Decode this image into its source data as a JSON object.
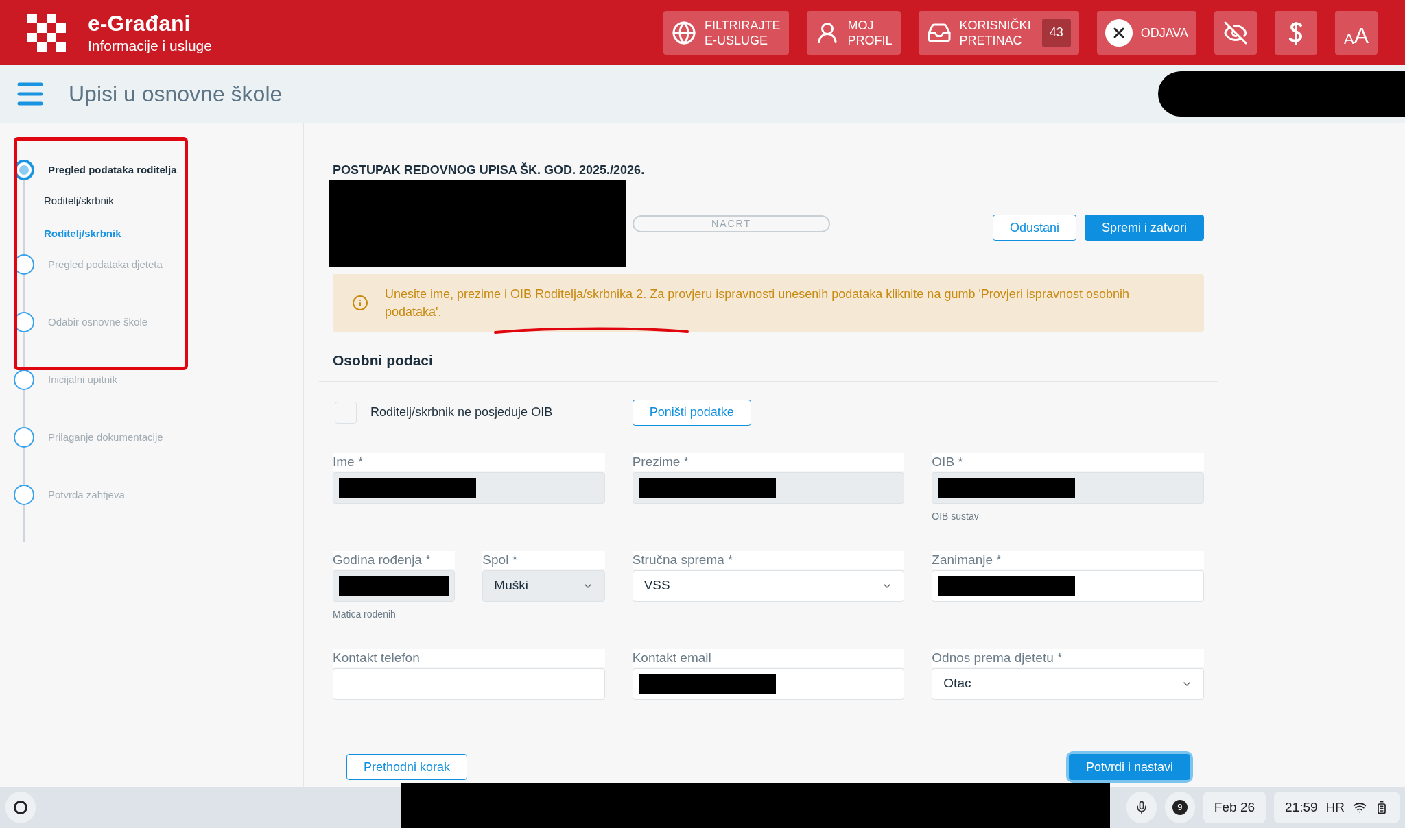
{
  "header": {
    "title": "e-Građani",
    "subtitle": "Informacije i usluge",
    "buttons": [
      {
        "kind": "globe",
        "lines": [
          "FILTRIRAJTE",
          "E-USLUGE"
        ]
      },
      {
        "kind": "profile",
        "lines": [
          "MOJ",
          "PROFIL"
        ]
      },
      {
        "kind": "inbox",
        "lines": [
          "KORISNIČKI",
          "PRETINAC"
        ],
        "badge": "43"
      },
      {
        "kind": "logout",
        "lines": [
          "ODJAVA"
        ]
      }
    ],
    "tools": [
      {
        "kind": "eye"
      },
      {
        "kind": "font"
      },
      {
        "kind": "size",
        "small": "A",
        "large": "A"
      }
    ]
  },
  "page_title": "Upisi u osnovne škole",
  "steps": [
    {
      "label": "Pregled podataka roditelja",
      "selected": true,
      "children": [
        {
          "label": "Roditelj/skrbnik",
          "selected": false
        },
        {
          "label": "Roditelj/skrbnik",
          "selected": true
        }
      ]
    },
    {
      "label": "Pregled podataka djeteta",
      "selected": false
    },
    {
      "label": "Odabir osnovne škole",
      "selected": false
    },
    {
      "label": "Inicijalni upitnik",
      "selected": false
    },
    {
      "label": "Prilaganje dokumentacije",
      "selected": false
    },
    {
      "label": "Potvrda zahtjeva",
      "selected": false
    }
  ],
  "form": {
    "heading": "POSTUPAK REDOVNOG UPISA ŠK. GOD. 2025./2026.",
    "status": "NACRT",
    "buttons": [
      {
        "label": "Odustani",
        "kind": "outline"
      },
      {
        "label": "Spremi i zatvori",
        "kind": "primary"
      }
    ],
    "alert": "Unesite ime, prezime i OIB Roditelja/skrbnika 2. Za provjeru ispravnosti unesenih podataka kliknite na gumb 'Provjeri ispravnost osobnih podataka'.",
    "section": "Osobni podaci",
    "no_oib": {
      "label": "Roditelj/skrbnik ne posjeduje OIB",
      "checked": false
    },
    "reset_button": "Poništi podatke",
    "rows": [
      [
        {
          "label": "Ime *",
          "kind": "text",
          "readonly": true,
          "redacted": true
        },
        {
          "label": "Prezime *",
          "kind": "text",
          "readonly": true,
          "redacted": true
        },
        {
          "label": "OIB *",
          "kind": "text",
          "readonly": true,
          "redacted": true,
          "helper": "OIB sustav"
        }
      ],
      [
        {
          "kind": "pair",
          "fields": [
            {
              "label": "Godina rođenja *",
              "kind": "text",
              "readonly": true,
              "redacted": true,
              "helper": "Matica rođenih"
            },
            {
              "label": "Spol *",
              "kind": "select",
              "readonly": true,
              "value": "Muški"
            }
          ]
        },
        {
          "label": "Stručna sprema *",
          "kind": "select",
          "readonly": false,
          "value": "VSS"
        },
        {
          "label": "Zanimanje *",
          "kind": "text",
          "readonly": false,
          "redacted": true
        }
      ],
      [
        {
          "label": "Kontakt telefon",
          "kind": "text",
          "readonly": false
        },
        {
          "label": "Kontakt email",
          "kind": "text",
          "readonly": false,
          "redacted": true
        },
        {
          "label": "Odnos prema djetetu *",
          "kind": "select",
          "readonly": false,
          "value": "Otac"
        }
      ]
    ],
    "footer": [
      {
        "label": "Prethodni korak",
        "kind": "outline"
      },
      {
        "label": "Potvrdi i nastavi",
        "kind": "primary"
      }
    ]
  },
  "taskbar": {
    "notifications": "9",
    "date": "Feb 26",
    "time": "21:59",
    "keyboard": "HR"
  }
}
